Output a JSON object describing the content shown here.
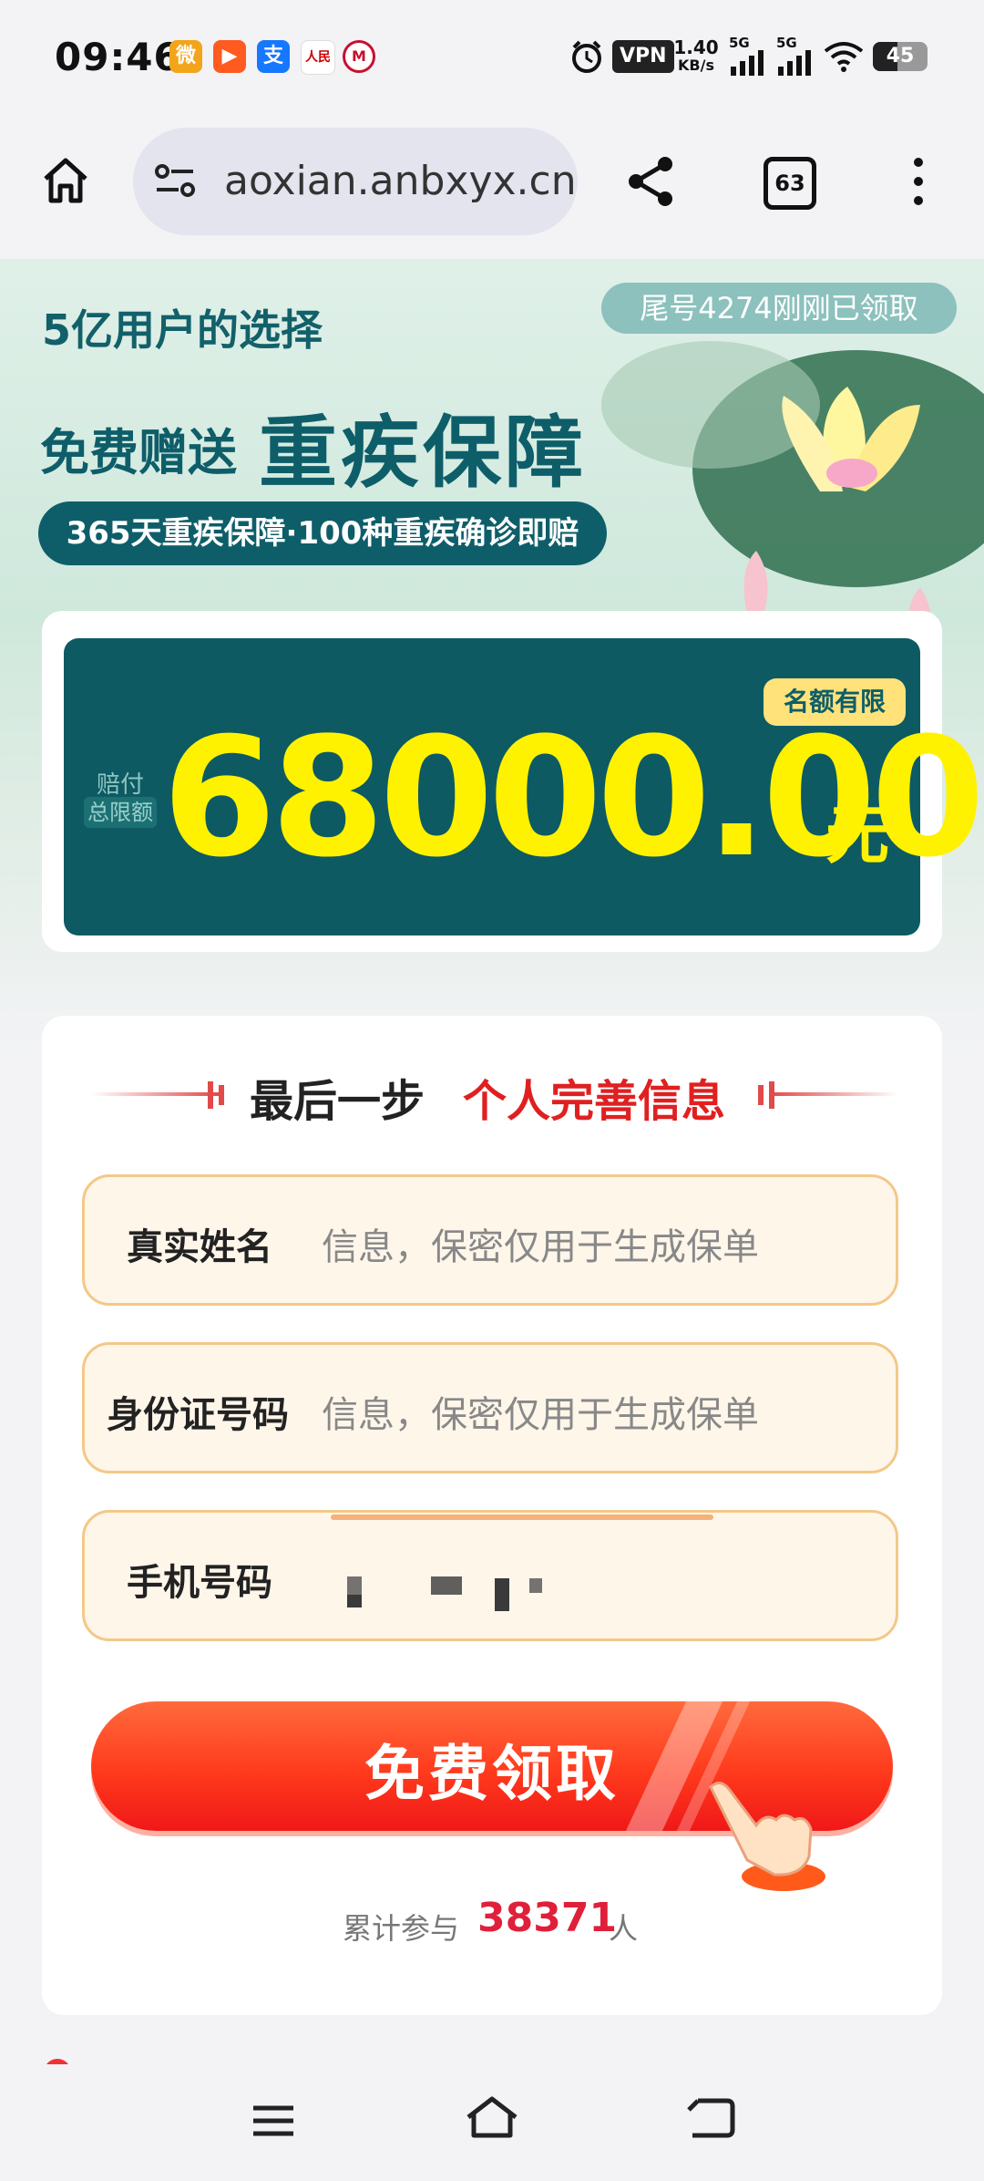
{
  "status_bar": {
    "time": "09:46",
    "vpn": "VPN",
    "net_speed_value": "1.40",
    "net_speed_unit": "KB/s",
    "signal1": "5G",
    "signal2": "5G",
    "battery": "45",
    "apps": [
      "weibo-icon",
      "kuaishou-icon",
      "alipay-icon",
      "peoples-daily-icon",
      "cmb-icon"
    ]
  },
  "browser": {
    "url": "aoxian.anbxyx.cn",
    "tab_count": "63"
  },
  "hero": {
    "slogan": "5亿用户的选择",
    "ticker": "尾号4274刚刚已领取",
    "headline_prefix": "免费赠送",
    "headline_main": "重疾保障",
    "sub_pill": "365天重疾保障·100种重疾确诊即赔"
  },
  "amount_card": {
    "limited_badge": "名额有限",
    "label_line1": "赔付",
    "label_line2": "总限额",
    "amount": "68000.00",
    "unit": "元"
  },
  "form": {
    "step_prefix": "最后一步",
    "step_title": "个人完善信息",
    "fields": [
      {
        "label": "真实姓名",
        "placeholder": "信息，保密仅用于生成保单"
      },
      {
        "label": "身份证号码",
        "placeholder": "信息，保密仅用于生成保单"
      },
      {
        "label": "手机号码",
        "placeholder": ""
      }
    ],
    "submit": "免费领取",
    "count_prefix": "累计参与",
    "count": "38371",
    "count_suffix": "人"
  },
  "colors": {
    "teal": "#0e5e6a",
    "amount_yellow": "#fff200",
    "cta_red": "#ff3a1c",
    "accent_red": "#e02020"
  }
}
